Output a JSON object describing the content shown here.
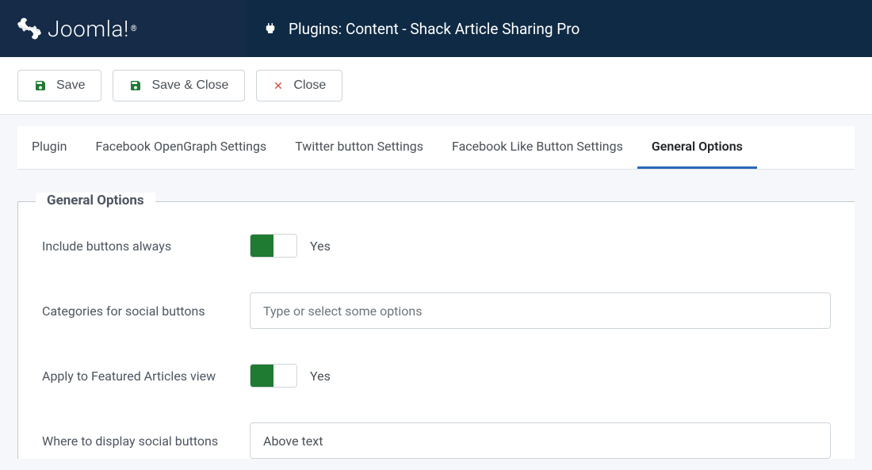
{
  "header": {
    "brand": "Joomla!",
    "title": "Plugins: Content - Shack Article Sharing Pro"
  },
  "toolbar": {
    "save": "Save",
    "save_close": "Save & Close",
    "close": "Close"
  },
  "tabs": [
    {
      "label": "Plugin",
      "active": false
    },
    {
      "label": "Facebook OpenGraph Settings",
      "active": false
    },
    {
      "label": "Twitter button Settings",
      "active": false
    },
    {
      "label": "Facebook Like Button Settings",
      "active": false
    },
    {
      "label": "General Options",
      "active": true
    }
  ],
  "fieldset": {
    "legend": "General Options",
    "fields": {
      "include_always": {
        "label": "Include buttons always",
        "value": "Yes",
        "on": true
      },
      "categories": {
        "label": "Categories for social buttons",
        "placeholder": "Type or select some options"
      },
      "featured": {
        "label": "Apply to Featured Articles view",
        "value": "Yes",
        "on": true
      },
      "where": {
        "label": "Where to display social buttons",
        "value": "Above text"
      }
    }
  }
}
